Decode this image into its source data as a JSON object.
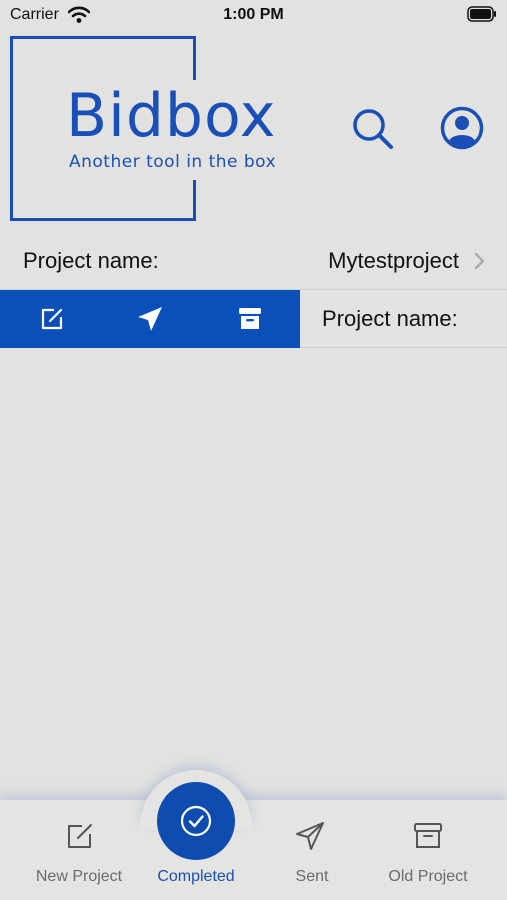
{
  "status_bar": {
    "carrier": "Carrier",
    "time": "1:00 PM"
  },
  "header": {
    "logo_title": "Bidbox",
    "logo_subtitle": "Another tool in the box",
    "brand_color": "#1b4fb8"
  },
  "list": [
    {
      "label": "Project name:",
      "value": "Mytestproject"
    },
    {
      "label": "Project name:",
      "actions": [
        "edit-icon",
        "send-icon",
        "archive-icon"
      ]
    }
  ],
  "tabbar": {
    "tabs": [
      {
        "label": "New Project",
        "icon": "edit-icon"
      },
      {
        "label": "Completed",
        "icon": "check-circle-icon",
        "active": true
      },
      {
        "label": "Sent",
        "icon": "send-icon"
      },
      {
        "label": "Old Project",
        "icon": "archive-icon"
      }
    ]
  }
}
